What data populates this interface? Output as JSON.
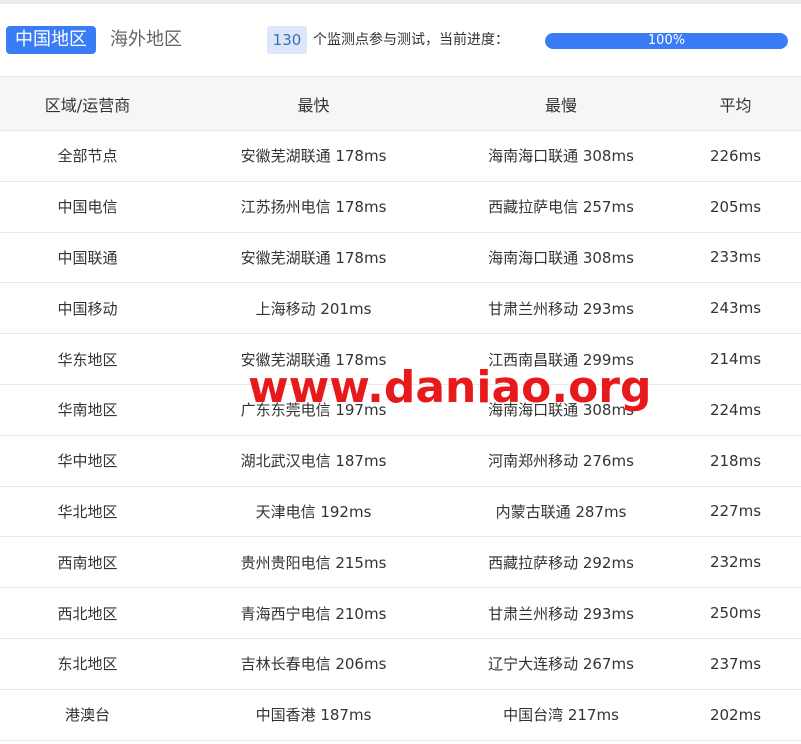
{
  "tabs": {
    "active": "中国地区",
    "inactive": "海外地区"
  },
  "status": {
    "count": "130",
    "text": "个监测点参与测试，当前进度：",
    "progress_label": "100%",
    "progress_fraction": 1.0
  },
  "table": {
    "headers": [
      "区域/运营商",
      "最快",
      "最慢",
      "平均"
    ],
    "rows": [
      [
        "全部节点",
        "安徽芜湖联通 178ms",
        "海南海口联通 308ms",
        "226ms"
      ],
      [
        "中国电信",
        "江苏扬州电信 178ms",
        "西藏拉萨电信 257ms",
        "205ms"
      ],
      [
        "中国联通",
        "安徽芜湖联通 178ms",
        "海南海口联通 308ms",
        "233ms"
      ],
      [
        "中国移动",
        "上海移动 201ms",
        "甘肃兰州移动 293ms",
        "243ms"
      ],
      [
        "华东地区",
        "安徽芜湖联通 178ms",
        "江西南昌联通 299ms",
        "214ms"
      ],
      [
        "华南地区",
        "广东东莞电信 197ms",
        "海南海口联通 308ms",
        "224ms"
      ],
      [
        "华中地区",
        "湖北武汉电信 187ms",
        "河南郑州移动 276ms",
        "218ms"
      ],
      [
        "华北地区",
        "天津电信 192ms",
        "内蒙古联通 287ms",
        "227ms"
      ],
      [
        "西南地区",
        "贵州贵阳电信 215ms",
        "西藏拉萨移动 292ms",
        "232ms"
      ],
      [
        "西北地区",
        "青海西宁电信 210ms",
        "甘肃兰州移动 293ms",
        "250ms"
      ],
      [
        "东北地区",
        "吉林长春电信 206ms",
        "辽宁大连移动 267ms",
        "237ms"
      ],
      [
        "港澳台",
        "中国香港 187ms",
        "中国台湾 217ms",
        "202ms"
      ]
    ]
  },
  "watermark": "www.daniao.org",
  "colors": {
    "accent": "#3a7cf5",
    "watermark": "#e8191b",
    "header_bg": "#f5f6f8"
  }
}
